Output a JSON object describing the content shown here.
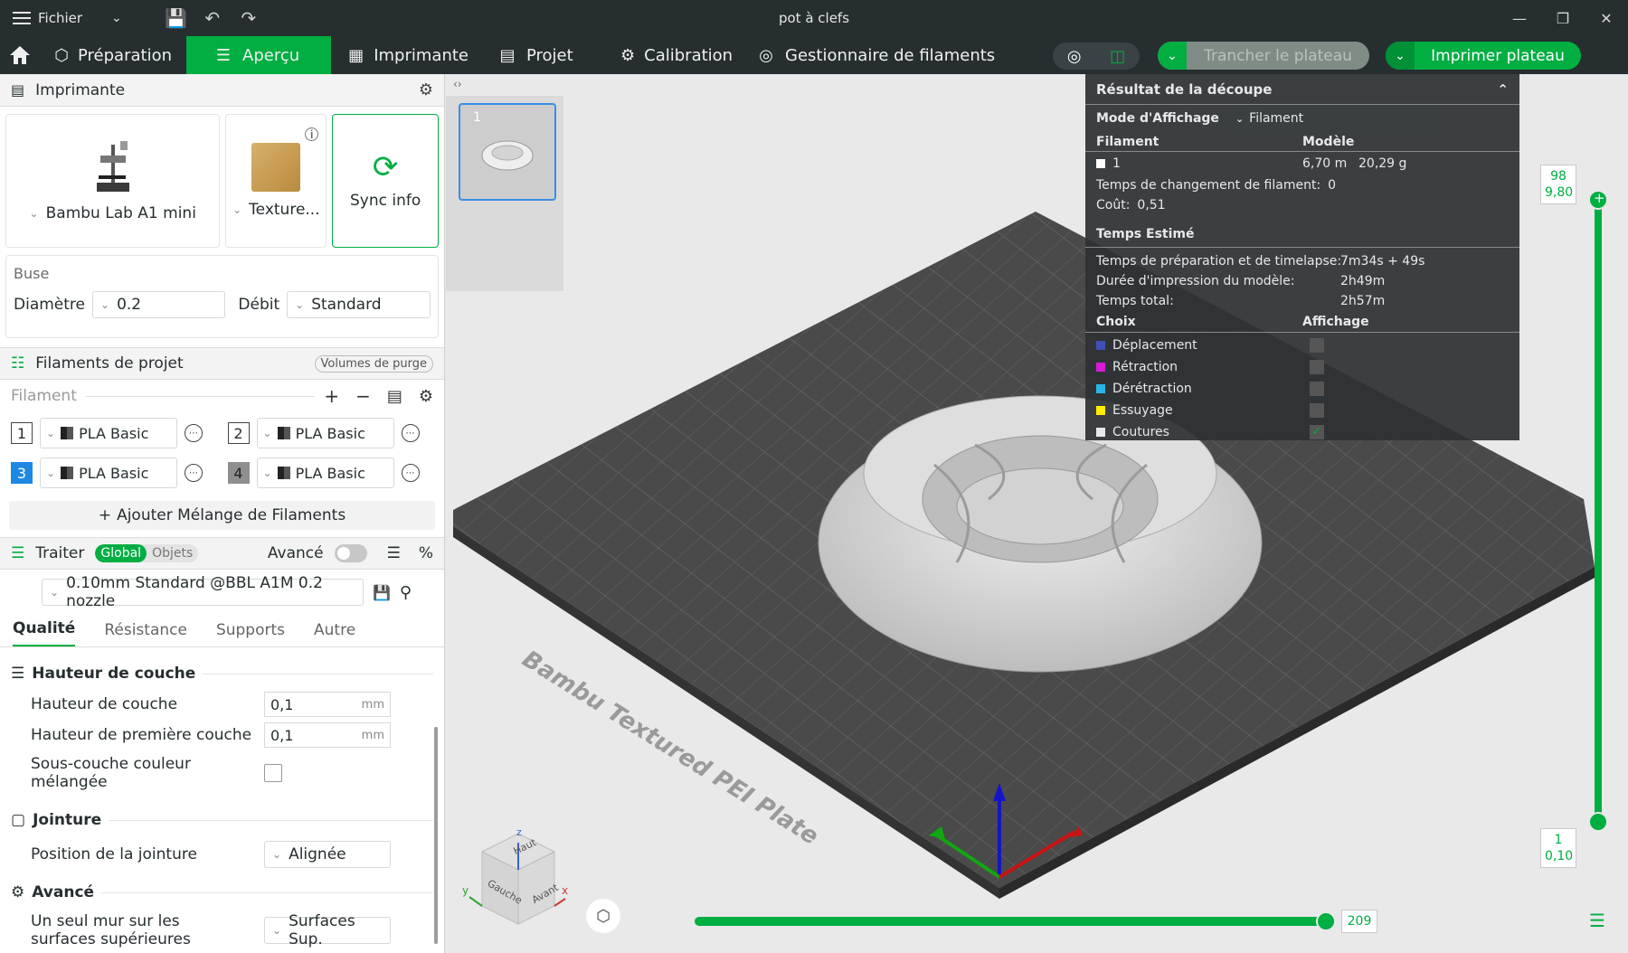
{
  "window": {
    "title": "pot à clefs",
    "menu_label": "Fichier"
  },
  "toolbar": {
    "tabs": [
      {
        "label": "Préparation"
      },
      {
        "label": "Aperçu"
      },
      {
        "label": "Imprimante"
      },
      {
        "label": "Projet"
      },
      {
        "label": "Calibration"
      },
      {
        "label": "Gestionnaire de filaments"
      }
    ],
    "slice_label": "Trancher le plateau",
    "print_label": "Imprimer plateau"
  },
  "printer": {
    "section_title": "Imprimante",
    "model": "Bambu Lab A1 mini",
    "plate": "Texture...",
    "sync_label": "Sync info"
  },
  "nozzle": {
    "section_label": "Buse",
    "diameter_label": "Diamètre",
    "diameter_value": "0.2",
    "flow_label": "Débit",
    "flow_value": "Standard"
  },
  "filaments": {
    "section_title": "Filaments de projet",
    "purge_label": "Volumes de purge",
    "list_label": "Filament",
    "items": [
      {
        "num": "1",
        "name": "PLA Basic"
      },
      {
        "num": "2",
        "name": "PLA Basic"
      },
      {
        "num": "3",
        "name": "PLA Basic"
      },
      {
        "num": "4",
        "name": "PLA Basic"
      }
    ],
    "add_mix_label": "Ajouter Mélange de Filaments"
  },
  "process": {
    "section_title": "Traiter",
    "global_label": "Global",
    "objects_label": "Objets",
    "advanced_label": "Avancé",
    "profile": "0.10mm Standard @BBL A1M 0.2 nozzle",
    "tabs": [
      "Qualité",
      "Résistance",
      "Supports",
      "Autre"
    ],
    "layer_group": "Hauteur de couche",
    "layer_height_label": "Hauteur de couche",
    "layer_height_value": "0,1",
    "first_layer_label": "Hauteur de première couche",
    "first_layer_value": "0,1",
    "unit_mm": "mm",
    "mixed_sublayer_label": "Sous-couche couleur mélangée",
    "seam_group": "Jointure",
    "seam_position_label": "Position de la jointure",
    "seam_position_value": "Alignée",
    "advanced_group": "Avancé",
    "single_wall_label": "Un seul mur sur les surfaces supérieures",
    "single_wall_value": "Surfaces Sup."
  },
  "viewport": {
    "plate_number": "1",
    "bed_label": "Bambu Textured PEI Plate",
    "cube_top": "Haut",
    "cube_left": "Gauche",
    "cube_front": "Avant",
    "axis_x": "x",
    "axis_y": "y",
    "axis_z": "z",
    "layer_top_num": "98",
    "layer_top_height": "9,80",
    "layer_bottom_num": "1",
    "layer_bottom_height": "0,10",
    "move_value": "209"
  },
  "slice_result": {
    "title": "Résultat de la découpe",
    "mode_label": "Mode d'Affichage",
    "mode_value": "Filament",
    "col_filament": "Filament",
    "col_model": "Modèle",
    "row_num": "1",
    "length": "6,70 m",
    "weight": "20,29 g",
    "change_time_label": "Temps de changement de filament:",
    "change_time_value": "0",
    "cost_label": "Coût:",
    "cost_value": "0,51",
    "time_title": "Temps Estimé",
    "prep_label": "Temps de préparation et de timelapse:",
    "prep_value": "7m34s + 49s",
    "model_time_label": "Durée d'impression du modèle:",
    "model_time_value": "2h49m",
    "total_label": "Temps total:",
    "total_value": "2h57m",
    "col_choice": "Choix",
    "col_display": "Affichage",
    "options": [
      {
        "label": "Déplacement",
        "color": "#3f51b5"
      },
      {
        "label": "Rétraction",
        "color": "#d81bd8"
      },
      {
        "label": "Dérétraction",
        "color": "#29b6e6"
      },
      {
        "label": "Essuyage",
        "color": "#ffee00"
      },
      {
        "label": "Coutures",
        "color": "#e8e8e8"
      }
    ]
  },
  "colors": {
    "accent": "#00ae42",
    "dark": "#262e30"
  }
}
